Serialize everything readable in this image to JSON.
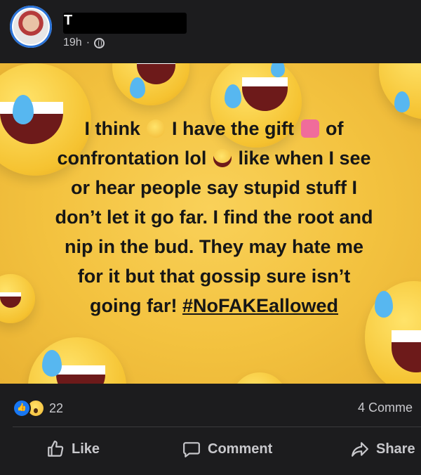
{
  "post": {
    "author_initial": "T",
    "timestamp": "19h",
    "text_lines": [
      "I think",
      "I have the gift",
      "of",
      "confrontation lol",
      "like when I see",
      "or hear people say stupid stuff I",
      "don’t let it go far. I find the root and",
      "nip in the bud. They may hate me",
      "for it but that gossip sure isn’t",
      "going far!",
      "#NoFAKEallowed"
    ]
  },
  "engagement": {
    "reaction_count": "22",
    "comments_label": "4 Comme"
  },
  "actions": {
    "like": "Like",
    "comment": "Comment",
    "share": "Share"
  },
  "icons": [
    "globe-icon",
    "like-icon",
    "comment-icon",
    "share-icon",
    "thinking-face-emoji",
    "heart-gift-emoji",
    "laughing-emoji"
  ],
  "colors": {
    "background": "#1c1c1e",
    "post_yellow": "#f3c23f",
    "text_light": "#c8c8cc",
    "like_blue": "#1877f2"
  }
}
